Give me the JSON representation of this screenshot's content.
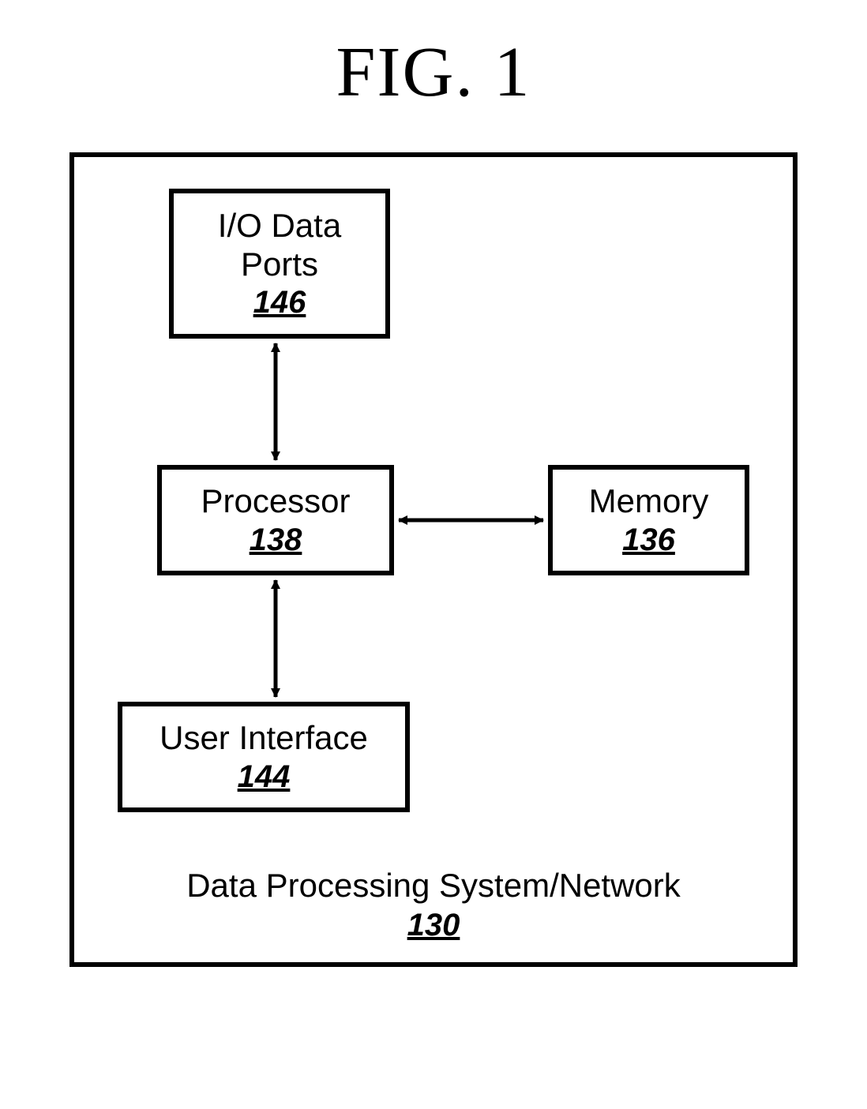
{
  "figure": {
    "title": "FIG. 1",
    "container": {
      "label": "Data Processing System/Network",
      "ref": "130"
    },
    "blocks": {
      "io": {
        "label": "I/O Data\nPorts",
        "ref": "146"
      },
      "processor": {
        "label": "Processor",
        "ref": "138"
      },
      "memory": {
        "label": "Memory",
        "ref": "136"
      },
      "ui": {
        "label": "User Interface",
        "ref": "144"
      }
    },
    "connections": [
      {
        "from": "io",
        "to": "processor",
        "bidirectional": true
      },
      {
        "from": "processor",
        "to": "memory",
        "bidirectional": true
      },
      {
        "from": "processor",
        "to": "ui",
        "bidirectional": true
      }
    ]
  }
}
